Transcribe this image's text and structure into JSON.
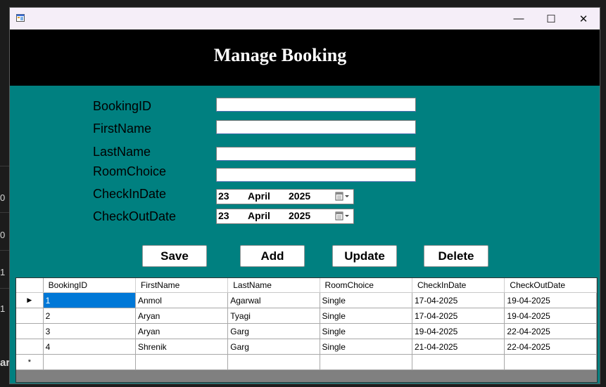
{
  "background": {
    "edge_text": [
      "0",
      "0",
      "1",
      "1",
      "ar"
    ]
  },
  "window": {
    "title": "",
    "controls": {
      "minimize": "—",
      "maximize": "☐",
      "close": "✕"
    }
  },
  "header": {
    "title": "Manage Booking"
  },
  "form": {
    "labels": {
      "booking_id": "BookingID",
      "first_name": "FirstName",
      "last_name": "LastName",
      "room_choice": "RoomChoice",
      "checkin_date": "CheckInDate",
      "checkout_date": "CheckOutDate"
    },
    "values": {
      "booking_id": "",
      "first_name": "",
      "last_name": "",
      "room_choice": ""
    },
    "checkin": {
      "day": "23",
      "month": "April",
      "year": "2025"
    },
    "checkout": {
      "day": "23",
      "month": "April",
      "year": "2025"
    }
  },
  "buttons": {
    "save": "Save",
    "add": "Add",
    "update": "Update",
    "delete": "Delete"
  },
  "grid": {
    "columns": [
      "BookingID",
      "FirstName",
      "LastName",
      "RoomChoice",
      "CheckInDate",
      "CheckOutDate"
    ],
    "rows": [
      [
        "1",
        "Anmol",
        "Agarwal",
        "Single",
        "17-04-2025",
        "19-04-2025"
      ],
      [
        "2",
        "Aryan",
        "Tyagi",
        "Single",
        "17-04-2025",
        "19-04-2025"
      ],
      [
        "3",
        "Aryan",
        "Garg",
        "Single",
        "19-04-2025",
        "22-04-2025"
      ],
      [
        "4",
        "Shrenik",
        "Garg",
        "Single",
        "21-04-2025",
        "22-04-2025"
      ]
    ],
    "current_row_marker": "▶",
    "new_row_marker": "*"
  },
  "colors": {
    "form_bg": "#008080",
    "header_bg": "#000000",
    "selection": "#0078d7"
  }
}
